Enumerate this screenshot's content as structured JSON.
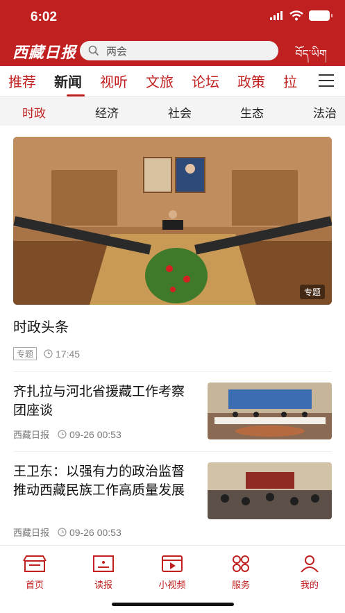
{
  "status": {
    "time": "6:02"
  },
  "header": {
    "logo_text": "西藏日报",
    "search_placeholder": "两会",
    "tibetan_label": "བོད་ཡིག"
  },
  "tabs": [
    "推荐",
    "新闻",
    "视听",
    "文旅",
    "论坛",
    "政策",
    "拉"
  ],
  "active_tab": "新闻",
  "subtabs": [
    "时政",
    "经济",
    "社会",
    "生态",
    "法治"
  ],
  "active_subtab": "时政",
  "featured": {
    "headline": "时政头条",
    "badge": "专题",
    "tag": "专题",
    "time": "17:45"
  },
  "news": [
    {
      "title": "齐扎拉与河北省援藏工作考察团座谈",
      "source": "西藏日报",
      "time": "09-26  00:53"
    },
    {
      "title": "王卫东：以强有力的政治监督推动西藏民族工作高质量发展",
      "source": "西藏日报",
      "time": "09-26  00:53"
    }
  ],
  "bottom_nav": [
    {
      "label": "首页",
      "icon": "home-icon"
    },
    {
      "label": "读报",
      "icon": "newspaper-icon"
    },
    {
      "label": "小视频",
      "icon": "video-icon"
    },
    {
      "label": "服务",
      "icon": "services-icon"
    },
    {
      "label": "我的",
      "icon": "profile-icon"
    }
  ],
  "colors": {
    "accent": "#c0201f"
  }
}
